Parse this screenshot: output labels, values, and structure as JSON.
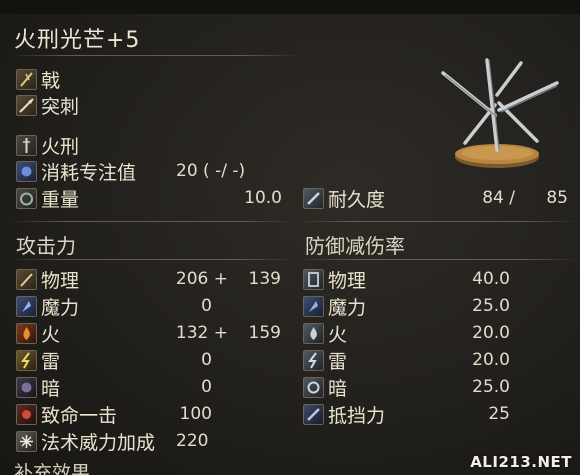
{
  "title": "火刑光芒+5",
  "weapon_type": "戟",
  "attack_type": "突刺",
  "skill": "火刑",
  "fp_cost": {
    "label": "消耗专注值",
    "value": "20 (   -/   -)"
  },
  "weight": {
    "label": "重量",
    "value": "10.0"
  },
  "durability": {
    "label": "耐久度",
    "current": "84 /",
    "max": "85"
  },
  "attack": {
    "header": "攻击力",
    "rows": [
      {
        "label": "物理",
        "base": "206 +",
        "bonus": "139",
        "icon": "physical-icon"
      },
      {
        "label": "魔力",
        "base": "0",
        "bonus": "",
        "icon": "magic-icon"
      },
      {
        "label": "火",
        "base": "132 +",
        "bonus": "159",
        "icon": "fire-icon"
      },
      {
        "label": "雷",
        "base": "0",
        "bonus": "",
        "icon": "lightning-icon"
      },
      {
        "label": "暗",
        "base": "0",
        "bonus": "",
        "icon": "dark-icon"
      },
      {
        "label": "致命一击",
        "base": "100",
        "bonus": "",
        "icon": "critical-icon"
      },
      {
        "label": "法术威力加成",
        "base": "220",
        "bonus": "",
        "icon": "spell-buff-icon"
      }
    ]
  },
  "defense": {
    "header": "防御减伤率",
    "rows": [
      {
        "label": "物理",
        "value": "40.0",
        "icon": "physical-guard-icon"
      },
      {
        "label": "魔力",
        "value": "25.0",
        "icon": "magic-guard-icon"
      },
      {
        "label": "火",
        "value": "20.0",
        "icon": "fire-guard-icon"
      },
      {
        "label": "雷",
        "value": "20.0",
        "icon": "lightning-guard-icon"
      },
      {
        "label": "暗",
        "value": "25.0",
        "icon": "dark-guard-icon"
      },
      {
        "label": "抵挡力",
        "value": "25",
        "icon": "stability-icon"
      }
    ]
  },
  "bottom_section": "补充效果",
  "watermark": "ALI213.NET",
  "colors": {
    "background": "#23201c",
    "text": "#e2dcc9",
    "divider": "#968c78"
  }
}
